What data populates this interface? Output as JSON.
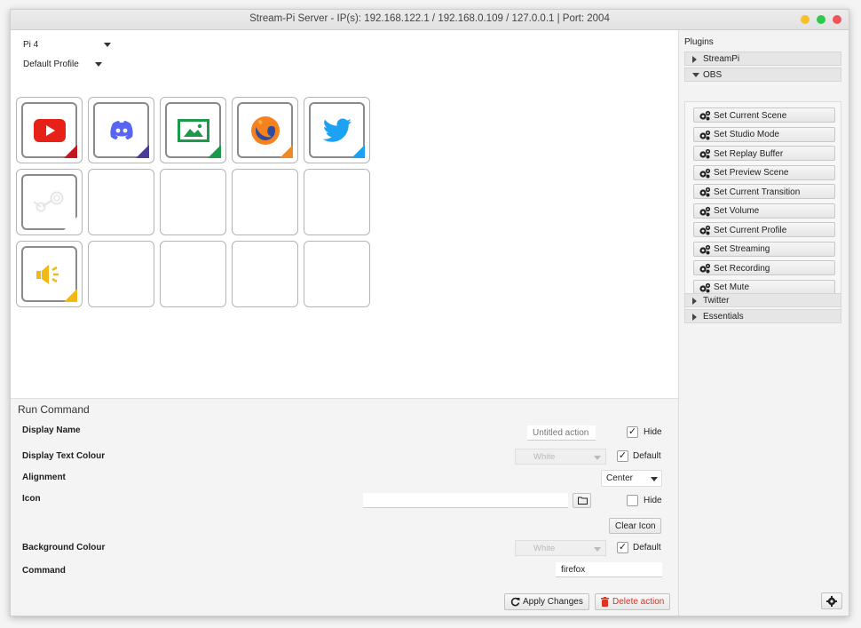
{
  "window": {
    "title": "Stream-Pi Server - IP(s): 192.168.122.1 / 192.168.0.109 / 127.0.0.1 | Port: 2004"
  },
  "client_selector": {
    "value": "Pi 4"
  },
  "profile_selector": {
    "value": "Default Profile"
  },
  "grid": {
    "rows": 3,
    "cols": 5,
    "actions": [
      {
        "icon": "youtube-icon",
        "corner_color": "#c4161c",
        "row": 0,
        "col": 0
      },
      {
        "icon": "discord-icon",
        "corner_color": "#4a3a9c",
        "row": 0,
        "col": 1
      },
      {
        "icon": "image-icon",
        "corner_color": "#1a9a4a",
        "row": 0,
        "col": 2
      },
      {
        "icon": "firefox-icon",
        "corner_color": "#f08a24",
        "row": 0,
        "col": 3
      },
      {
        "icon": "twitter-icon",
        "corner_color": "#1da1f2",
        "row": 0,
        "col": 4
      },
      {
        "icon": "steam-icon",
        "corner_color": "#ffffff",
        "row": 1,
        "col": 0
      },
      {
        "icon": "speaker-icon",
        "corner_color": "#f2b914",
        "row": 2,
        "col": 0
      }
    ]
  },
  "plugins": {
    "title": "Plugins",
    "sections": [
      {
        "label": "StreamPi",
        "expanded": false
      },
      {
        "label": "OBS",
        "expanded": true
      },
      {
        "label": "Twitter",
        "expanded": false
      },
      {
        "label": "Essentials",
        "expanded": false
      }
    ],
    "obs_actions": [
      "Set Current Scene",
      "Set Studio Mode",
      "Set Replay Buffer",
      "Set Preview Scene",
      "Set Current Transition",
      "Set Volume",
      "Set Current Profile",
      "Set Streaming",
      "Set Recording",
      "Set Mute"
    ]
  },
  "properties": {
    "section_title": "Run Command",
    "display_name": {
      "label": "Display Name",
      "placeholder": "Untitled action",
      "value": ""
    },
    "hide_name": {
      "label": "Hide",
      "checked": true
    },
    "display_text_colour": {
      "label": "Display Text Colour",
      "value": "White"
    },
    "text_colour_default": {
      "label": "Default",
      "checked": true
    },
    "alignment": {
      "label": "Alignment",
      "value": "Center"
    },
    "icon": {
      "label": "Icon",
      "value": ""
    },
    "hide_icon": {
      "label": "Hide",
      "checked": false
    },
    "clear_icon": "Clear Icon",
    "background_colour": {
      "label": "Background Colour",
      "value": "White"
    },
    "background_default": {
      "label": "Default",
      "checked": true
    },
    "command": {
      "label": "Command",
      "value": "firefox"
    },
    "apply_button": "Apply Changes",
    "delete_button": "Delete action"
  },
  "colors": {
    "accent_red": "#e0301e",
    "youtube_red": "#e62117",
    "discord_blue": "#5865f2",
    "twitter_blue": "#1da1f2",
    "firefox_orange": "#f5821f",
    "speaker_yellow": "#f2b914"
  }
}
